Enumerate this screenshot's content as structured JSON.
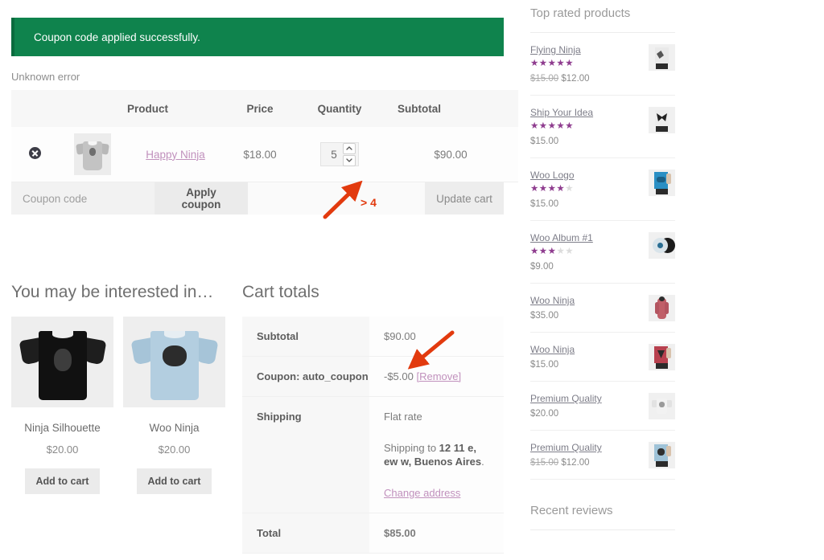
{
  "notice": {
    "success_message": "Coupon code applied successfully."
  },
  "error": {
    "text": "Unknown error"
  },
  "cart_table": {
    "headers": {
      "remove": "",
      "thumbnail": "",
      "product": "Product",
      "price": "Price",
      "quantity": "Quantity",
      "subtotal": "Subtotal"
    },
    "rows": [
      {
        "remove_icon": "remove-x-icon",
        "thumbnail_icon": "product-thumbnail-grey-tshirt",
        "product_name": "Happy Ninja",
        "price": "$18.00",
        "quantity": "5",
        "subtotal": "$90.00"
      }
    ]
  },
  "coupon_row": {
    "input_value": "",
    "input_placeholder": "Coupon code",
    "apply_label": "Apply coupon",
    "update_label": "Update cart"
  },
  "upsells": {
    "title": "You may be interested in…",
    "products": [
      {
        "name": "Ninja Silhouette",
        "price": "$20.00",
        "button": "Add to cart",
        "image": "black-tshirt-photo"
      },
      {
        "name": "Woo Ninja",
        "price": "$20.00",
        "button": "Add to cart",
        "image": "light-blue-tshirt-photo"
      }
    ]
  },
  "cart_totals": {
    "title": "Cart totals",
    "rows": [
      {
        "label": "Subtotal",
        "value": "$90.00"
      },
      {
        "label": "Coupon: auto_coupon",
        "value": "-$5.00",
        "remove_link": "[Remove]"
      },
      {
        "label": "Shipping",
        "method": "Flat rate",
        "shipping_to_prefix": "Shipping to ",
        "shipping_address": "12 11 e, ew w, Buenos Aires",
        "shipping_to_suffix": ".",
        "change_address_link": "Change address"
      },
      {
        "label": "Total",
        "value": "$85.00"
      }
    ]
  },
  "sidebar": {
    "top_rated_title": "Top rated products",
    "recent_reviews_title": "Recent reviews",
    "products": [
      {
        "name": "Flying Ninja",
        "stars": 5,
        "price_old": "$15.00",
        "price": "$12.00",
        "thumb": "flying-ninja-thumb"
      },
      {
        "name": "Ship Your Idea",
        "stars": 5,
        "price_old": "",
        "price": "$15.00",
        "thumb": "ship-your-idea-thumb"
      },
      {
        "name": "Woo Logo",
        "stars": 4,
        "price_old": "",
        "price": "$15.00",
        "thumb": "woo-logo-thumb"
      },
      {
        "name": "Woo Album #1",
        "stars": 3,
        "price_old": "",
        "price": "$9.00",
        "thumb": "woo-album-thumb"
      },
      {
        "name": "Woo Ninja",
        "stars": 0,
        "price_old": "",
        "price": "$35.00",
        "thumb": "woo-ninja-hoodie-thumb"
      },
      {
        "name": "Woo Ninja",
        "stars": 0,
        "price_old": "",
        "price": "$15.00",
        "thumb": "woo-ninja-red-thumb"
      },
      {
        "name": "Premium Quality",
        "stars": 0,
        "price_old": "",
        "price": "$20.00",
        "thumb": "premium-white-thumb"
      },
      {
        "name": "Premium Quality",
        "stars": 0,
        "price_old": "$15.00",
        "price": "$12.00",
        "thumb": "premium-blue-thumb"
      }
    ]
  },
  "annotations": {
    "quantity_note": "> 4",
    "arrow_color": "#e23a0e",
    "arrow_quantity_name": "red-arrow-pointing-to-quantity",
    "arrow_coupon_name": "red-arrow-pointing-to-coupon-remove"
  },
  "colors": {
    "success_green": "#0f834d",
    "link_mauve": "#c191bd",
    "star_purple": "#8f3d8f",
    "annotation_red": "#e23a0e"
  }
}
